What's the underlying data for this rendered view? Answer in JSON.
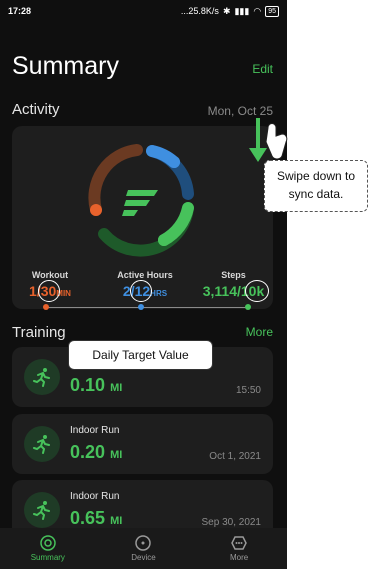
{
  "status_bar": {
    "time": "17:28",
    "network_speed": "...25.8K/s",
    "battery": "95"
  },
  "header": {
    "title": "Summary",
    "edit_label": "Edit"
  },
  "activity": {
    "section_title": "Activity",
    "date": "Mon, Oct 25",
    "metrics": [
      {
        "label": "Workout",
        "value": "1/30",
        "unit": "MIN",
        "color": "#e8622c"
      },
      {
        "label": "Active Hours",
        "value": "2/12",
        "unit": "HRS",
        "color": "#3f8fe0"
      },
      {
        "label": "Steps",
        "value": "3,114/10k",
        "unit": "",
        "color": "#47c25b"
      }
    ]
  },
  "training": {
    "section_title": "Training",
    "more_label": "More",
    "items": [
      {
        "name": "",
        "distance": "0.10",
        "unit": "MI",
        "date": "15:50"
      },
      {
        "name": "Indoor Run",
        "distance": "0.20",
        "unit": "MI",
        "date": "Oct 1, 2021"
      },
      {
        "name": "Indoor Run",
        "distance": "0.65",
        "unit": "MI",
        "date": "Sep 30, 2021"
      }
    ]
  },
  "nav": {
    "items": [
      {
        "label": "Summary",
        "icon": "summary-icon"
      },
      {
        "label": "Device",
        "icon": "device-icon"
      },
      {
        "label": "More",
        "icon": "more-icon"
      }
    ]
  },
  "annotations": {
    "sync": "Swipe down to sync data.",
    "target": "Daily Target Value"
  },
  "colors": {
    "accent": "#47c25b",
    "workout": "#e8622c",
    "active": "#3f8fe0",
    "steps": "#47c25b"
  }
}
